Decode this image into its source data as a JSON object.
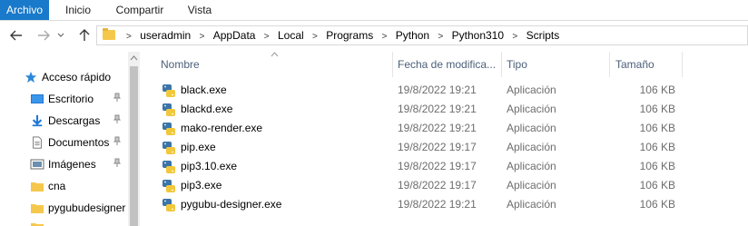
{
  "ribbon": {
    "tabs": [
      {
        "label": "Archivo",
        "active": true
      },
      {
        "label": "Inicio",
        "active": false
      },
      {
        "label": "Compartir",
        "active": false
      },
      {
        "label": "Vista",
        "active": false
      }
    ]
  },
  "nav": {
    "back_icon": "arrow-left-icon",
    "forward_icon": "arrow-right-icon",
    "recent_icon": "chevron-down-icon",
    "up_icon": "arrow-up-icon"
  },
  "address": {
    "crumbs": [
      "useradmin",
      "AppData",
      "Local",
      "Programs",
      "Python",
      "Python310",
      "Scripts"
    ],
    "separator": ">"
  },
  "sidebar": {
    "items": [
      {
        "label": "Acceso rápido",
        "icon": "star-icon",
        "pinned": false
      },
      {
        "label": "Escritorio",
        "icon": "desktop-icon",
        "pinned": true
      },
      {
        "label": "Descargas",
        "icon": "download-icon",
        "pinned": true
      },
      {
        "label": "Documentos",
        "icon": "document-icon",
        "pinned": true
      },
      {
        "label": "Imágenes",
        "icon": "images-icon",
        "pinned": true
      },
      {
        "label": "cna",
        "icon": "folder-icon",
        "pinned": false
      },
      {
        "label": "pygubudesigner",
        "icon": "folder-icon",
        "pinned": false
      }
    ],
    "pin_glyph": "📌"
  },
  "columns": {
    "name": "Nombre",
    "date": "Fecha de modifica...",
    "type": "Tipo",
    "size": "Tamaño"
  },
  "files": [
    {
      "name": "black.exe",
      "date": "19/8/2022 19:21",
      "type": "Aplicación",
      "size": "106 KB"
    },
    {
      "name": "blackd.exe",
      "date": "19/8/2022 19:21",
      "type": "Aplicación",
      "size": "106 KB"
    },
    {
      "name": "mako-render.exe",
      "date": "19/8/2022 19:21",
      "type": "Aplicación",
      "size": "106 KB"
    },
    {
      "name": "pip.exe",
      "date": "19/8/2022 19:17",
      "type": "Aplicación",
      "size": "106 KB"
    },
    {
      "name": "pip3.10.exe",
      "date": "19/8/2022 19:17",
      "type": "Aplicación",
      "size": "106 KB"
    },
    {
      "name": "pip3.exe",
      "date": "19/8/2022 19:17",
      "type": "Aplicación",
      "size": "106 KB"
    },
    {
      "name": "pygubu-designer.exe",
      "date": "19/8/2022 19:21",
      "type": "Aplicación",
      "size": "106 KB"
    }
  ],
  "colors": {
    "accent": "#1979ca",
    "header_text": "#4c607a",
    "muted_text": "#6d6d6d"
  }
}
